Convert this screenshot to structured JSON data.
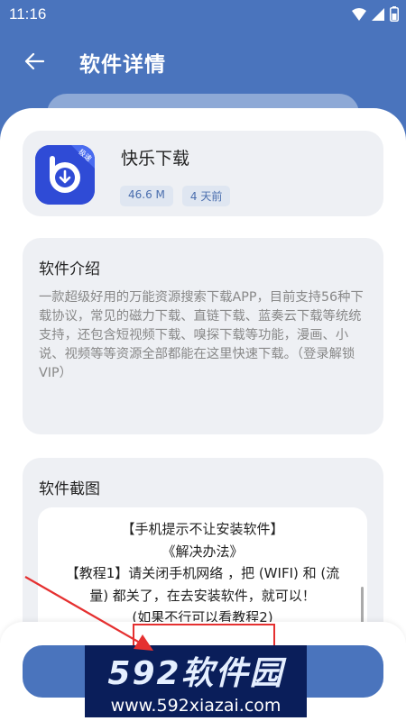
{
  "status_bar": {
    "time": "11:16"
  },
  "app_bar": {
    "title": "软件详情"
  },
  "app_info": {
    "name": "快乐下载",
    "size": "46.6 M",
    "updated": "4 天前",
    "icon_badge": "极速",
    "icon_color": "#2f4bd6"
  },
  "intro": {
    "title": "软件介绍",
    "text": "一款超级好用的万能资源搜索下载APP，目前支持56种下载协议，常见的磁力下载、直链下载、蓝奏云下载等统统支持，还包含短视频下载、嗅探下载等功能，漫画、小说、视频等等资源全部都能在这里快速下载。（登录解锁VIP）"
  },
  "screenshots": {
    "title": "软件截图",
    "lines": [
      "【手机提示不让安装软件】",
      "《解决办法》",
      "【教程1】请关闭手机网络 ，把 (WIFI) 和 (流",
      "量) 都关了，在去安装软件，就可以！",
      "(如果不行可以看教程2)"
    ]
  },
  "watermark": {
    "title": "592软件园",
    "url": "www.592xiazai.com"
  },
  "colors": {
    "primary": "#4a74bd",
    "card_bg": "#eef0f4",
    "badge_text": "#4a6eae",
    "annotation": "#e53030"
  }
}
